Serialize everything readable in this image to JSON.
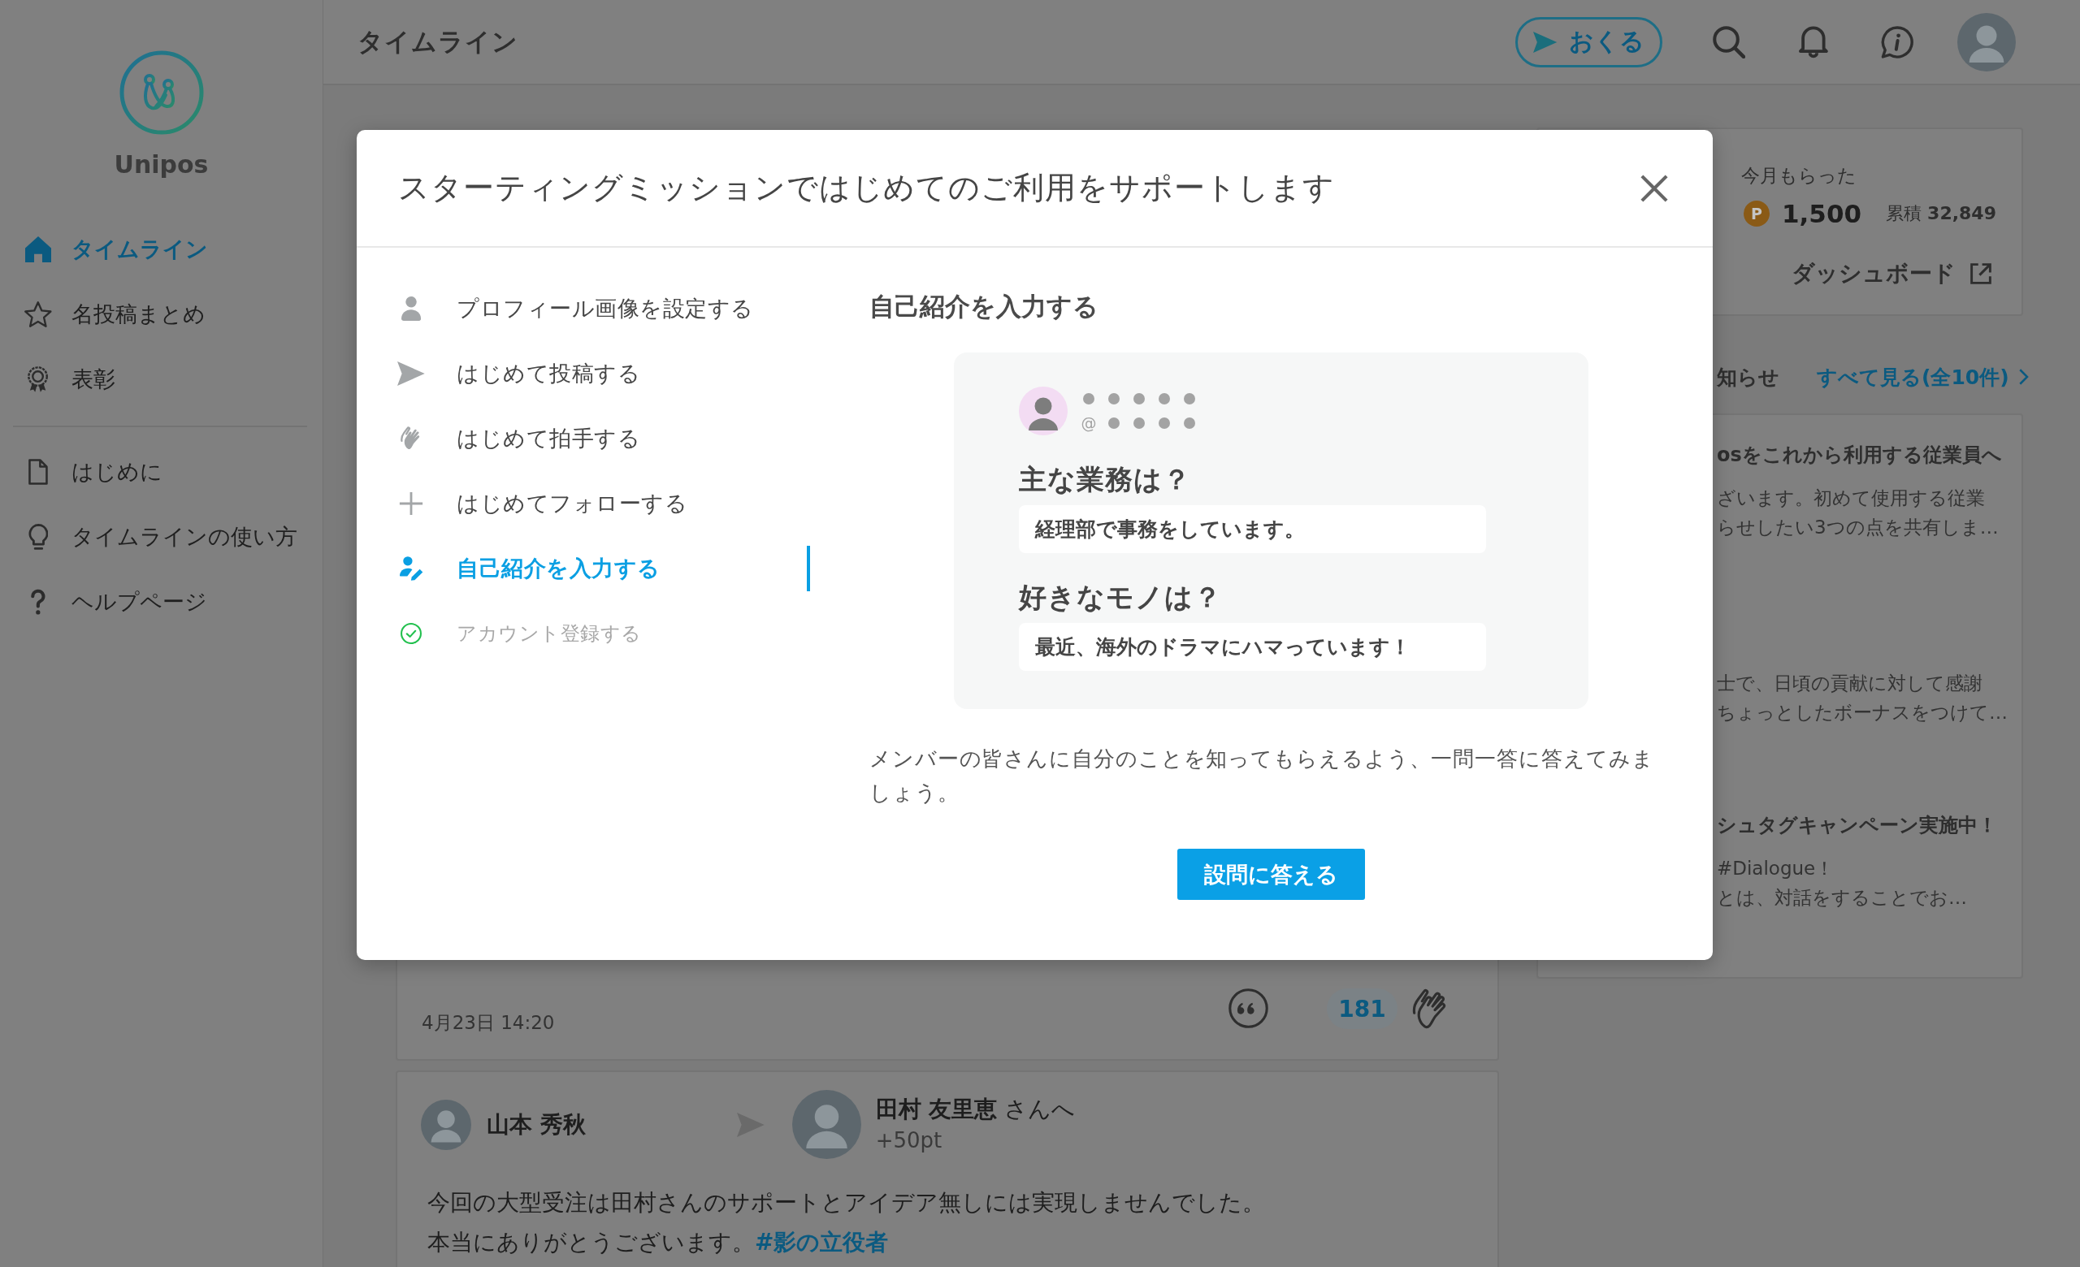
{
  "sidebar": {
    "logo": "Unipos",
    "nav": [
      {
        "label": "タイムライン",
        "selected": true
      },
      {
        "label": "名投稿まとめ",
        "selected": false
      },
      {
        "label": "表彰",
        "selected": false
      }
    ],
    "links": [
      "はじめに",
      "タイムラインの使い方",
      "ヘルプページ"
    ]
  },
  "header": {
    "title": "タイムライン",
    "send_button": "おくる"
  },
  "feed": {
    "post_footer": {
      "timestamp": "4月23日 14:20",
      "clap_count": "181"
    },
    "post": {
      "sender": "山本 秀秋",
      "recipient": "**田村 友里恵** さんへ",
      "points": "+50pt",
      "message": [
        "今回の大型受注は田村さんのサポートとアイデア無しには実現しませんでした。",
        "本当にありがとうございます。"
      ],
      "hashtag": "#影の立役者"
    }
  },
  "dashboard": {
    "label": "今月もらった",
    "coin": "P",
    "points": "1,500",
    "total": "累積 **32,849**",
    "link": "ダッシュボード"
  },
  "announcements": {
    "heading": "知らせ",
    "see_all": "すべて見る(全10件)",
    "items": [
      {
        "title": "osをこれから利用する従業員へ",
        "body": [
          "ざいます。初めて使用する従業",
          "らせしたい3つの点を共有しま…"
        ]
      },
      {
        "body": [
          "士で、日頃の貢献に対して感謝",
          "ちょっとしたボーナスをつけて…"
        ]
      },
      {
        "title": "シュタグキャンペーン実施中！",
        "body": [
          "#Dialogue！",
          "とは、対話をすることでお…"
        ]
      }
    ]
  },
  "modal": {
    "title": "スターティングミッションではじめてのご利用をサポートします",
    "steps": [
      {
        "label": "プロフィール画像を設定する",
        "selected": false,
        "done": false
      },
      {
        "label": "はじめて投稿する",
        "selected": false,
        "done": false
      },
      {
        "label": "はじめて拍手する",
        "selected": false,
        "done": false
      },
      {
        "label": "はじめてフォローする",
        "selected": false,
        "done": false
      },
      {
        "label": "自己紹介を入力する",
        "selected": true,
        "done": false
      },
      {
        "label": "アカウント登録する",
        "selected": false,
        "done": true
      }
    ],
    "heading": "自己紹介を入力する",
    "preview": {
      "handle_prefix": "@",
      "questions": [
        {
          "question": "主な業務は？",
          "answer": "経理部で事務をしています。"
        },
        {
          "question": "好きなモノは？",
          "answer": "最近、海外のドラマにハマっています！"
        }
      ]
    },
    "description": "メンバーの皆さんに自分のことを知ってもらえるよう、一問一答に答えてみましょう。",
    "button": "設問に答える"
  }
}
